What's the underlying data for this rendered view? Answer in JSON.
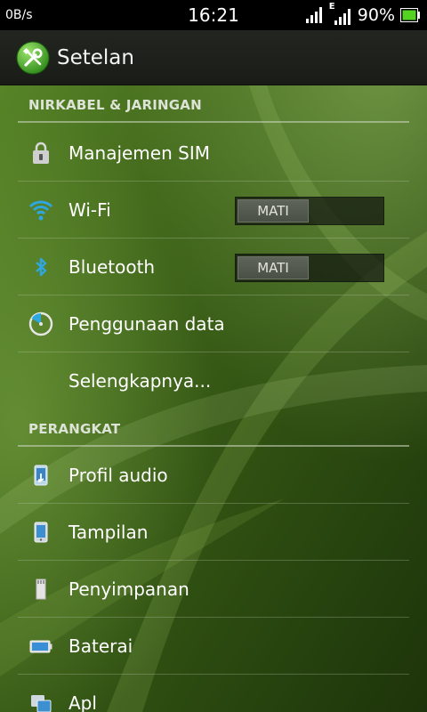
{
  "status_bar": {
    "net_speed": "0B/s",
    "time": "16:21",
    "network_type": "E",
    "battery_percent": "90%",
    "icons": [
      "signal-icon",
      "signal-icon",
      "battery-icon"
    ]
  },
  "action_bar": {
    "title": "Setelan",
    "icon": "settings-tools-icon"
  },
  "sections": {
    "wireless": {
      "header": "NIRKABEL & JARINGAN",
      "items": {
        "sim": {
          "label": "Manajemen SIM",
          "icon": "sim-lock-icon"
        },
        "wifi": {
          "label": "Wi-Fi",
          "icon": "wifi-icon",
          "toggle": "MATI"
        },
        "bluetooth": {
          "label": "Bluetooth",
          "icon": "bluetooth-icon",
          "toggle": "MATI"
        },
        "data_usage": {
          "label": "Penggunaan data",
          "icon": "data-usage-icon"
        },
        "more": {
          "label": "Selengkapnya..."
        }
      }
    },
    "device": {
      "header": "PERANGKAT",
      "items": {
        "audio": {
          "label": "Profil audio",
          "icon": "audio-profile-icon"
        },
        "display": {
          "label": "Tampilan",
          "icon": "display-icon"
        },
        "storage": {
          "label": "Penyimpanan",
          "icon": "storage-icon"
        },
        "battery": {
          "label": "Baterai",
          "icon": "battery-icon"
        },
        "apps": {
          "label": "Apl",
          "icon": "apps-icon"
        }
      }
    }
  },
  "colors": {
    "status_bar_bg": "#000000",
    "action_bar_bg": "#1f211d",
    "accent_blue": "#2fa6e0",
    "wallpaper_green": "#3a5e12"
  }
}
